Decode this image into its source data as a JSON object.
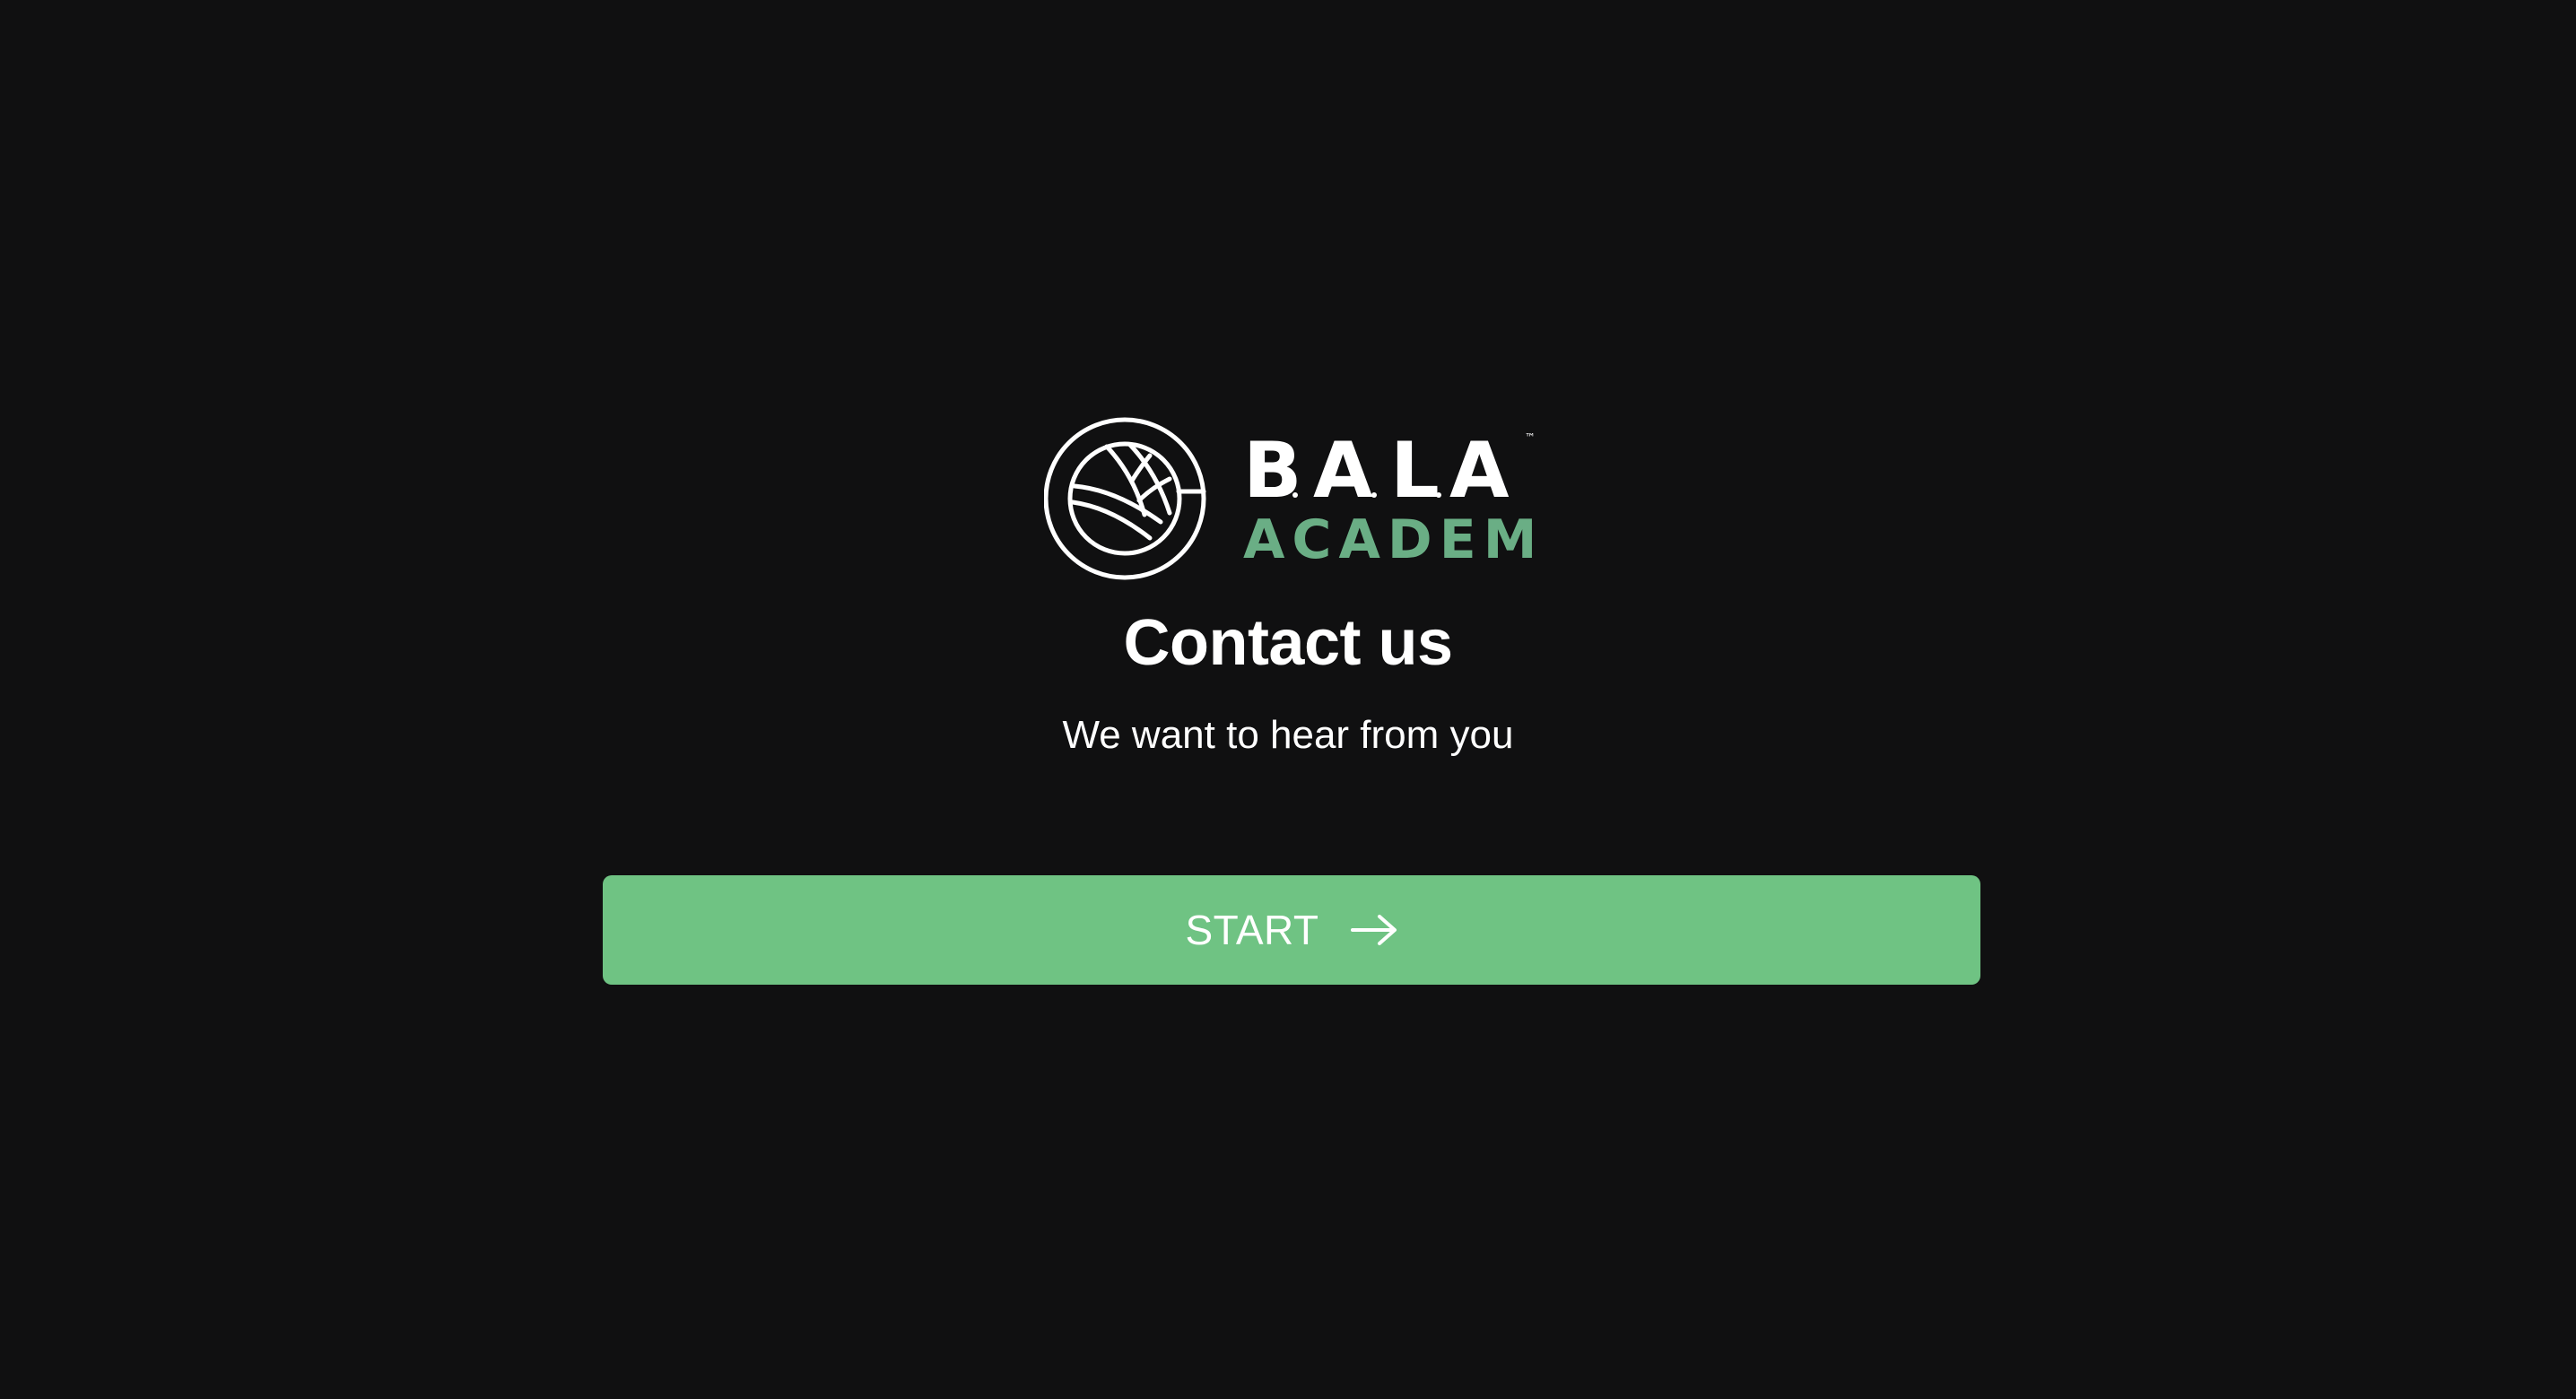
{
  "logo": {
    "wordmark_top": "B.A.L.A",
    "wordmark_bottom": "ACADEMY",
    "trademark": "™",
    "icon": "volleyball-icon",
    "colors": {
      "primary": "#ffffff",
      "accent": "#6aae85"
    }
  },
  "heading": {
    "title": "Contact us",
    "subtitle": "We want to hear from you"
  },
  "start_button": {
    "label": "START",
    "icon": "arrow-right-icon",
    "color": "#6fc383"
  },
  "colors": {
    "background": "#101011",
    "text": "#ffffff"
  }
}
